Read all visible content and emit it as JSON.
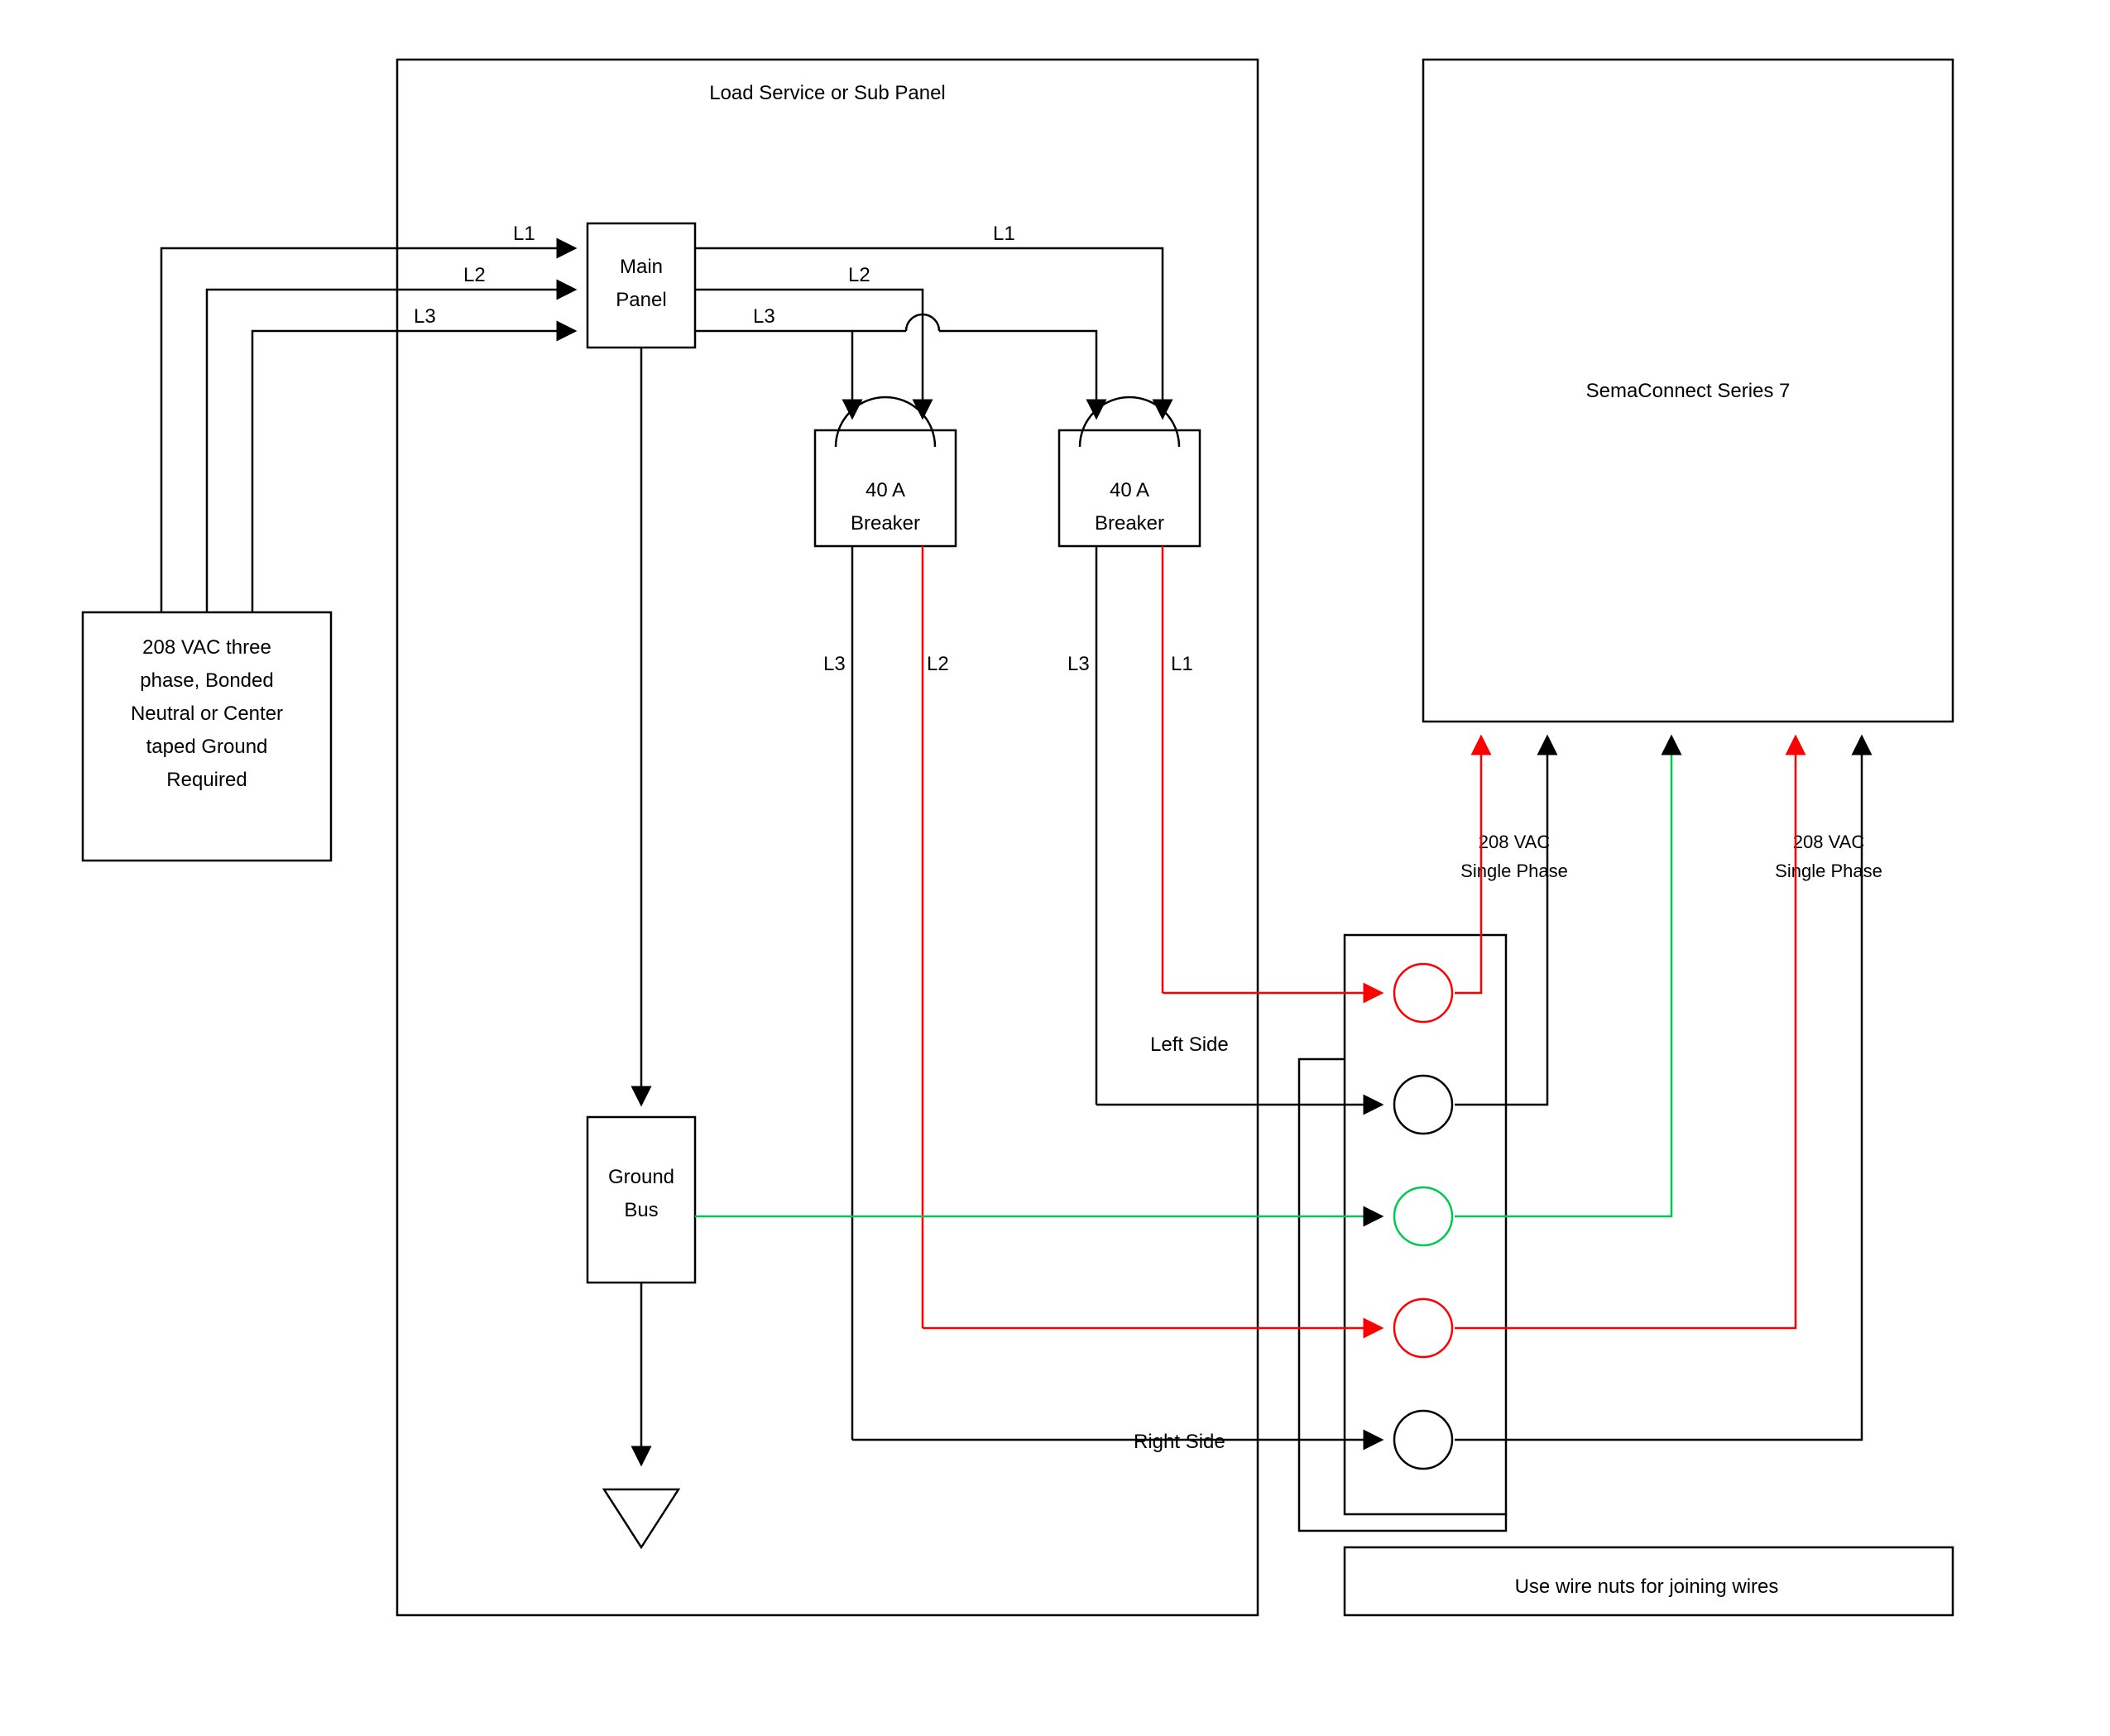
{
  "panel": {
    "title": "Load Service or Sub Panel",
    "main_panel_l1": "Main",
    "main_panel_l2": "Panel",
    "ground_bus_l1": "Ground",
    "ground_bus_l2": "Bus",
    "breaker1_l1": "40 A",
    "breaker1_l2": "Breaker",
    "breaker2_l1": "40 A",
    "breaker2_l2": "Breaker"
  },
  "source": {
    "l1": "208 VAC three",
    "l2": "phase, Bonded",
    "l3": "Neutral or Center",
    "l4": "taped Ground",
    "l5": "Required"
  },
  "labels": {
    "L1_in": "L1",
    "L2_in": "L2",
    "L3_in": "L3",
    "L1_out": "L1",
    "L2_out": "L2",
    "L3_out": "L3",
    "brk1_L3": "L3",
    "brk1_L2": "L2",
    "brk2_L3": "L3",
    "brk2_L1": "L1",
    "left_side": "Left Side",
    "right_side": "Right Side",
    "vac1_l1": "208 VAC",
    "vac1_l2": "Single Phase",
    "vac2_l1": "208 VAC",
    "vac2_l2": "Single Phase"
  },
  "device": {
    "title": "SemaConnect Series 7"
  },
  "note": {
    "text": "Use wire nuts for joining wires"
  }
}
